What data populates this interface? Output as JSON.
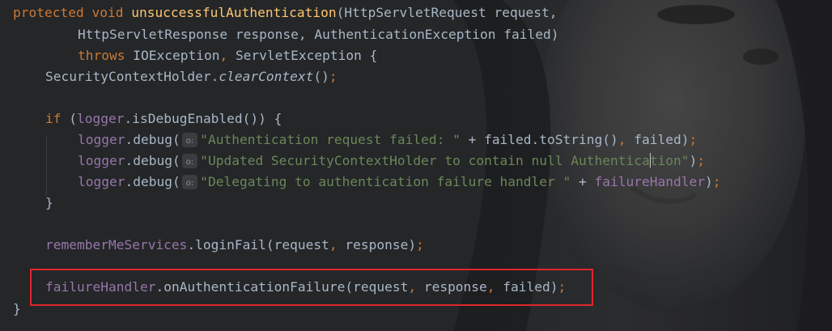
{
  "editor": {
    "theme": "dark",
    "colors": {
      "background": "#242628",
      "keyword": "#cc7832",
      "method_declaration": "#ffc66d",
      "identifier": "#a9b7c6",
      "field": "#9876aa",
      "string": "#6a8759",
      "highlight_box": "#e0262b"
    },
    "hint_icon": "parameter-name-hint-icon",
    "hint_label": "o:",
    "lines": {
      "l1": {
        "kw_protected": "protected",
        "kw_void": "void",
        "method_name": "unsuccessfulAuthentication",
        "rest": "(HttpServletRequest request,"
      },
      "l2": {
        "text1": "HttpServletResponse response, AuthenticationException failed)"
      },
      "l3": {
        "kw_throws": "throws",
        "text1": "IOException",
        "comma": ",",
        "text2": "ServletException {"
      },
      "l4": {
        "text1": "SecurityContextHolder.",
        "method": "clearContext",
        "text2": "()",
        "semi": ";"
      },
      "l6": {
        "kw_if": "if",
        "text1": "(",
        "field": "logger",
        "text2": ".isDebugEnabled()) {"
      },
      "l7": {
        "field": "logger",
        "text1": ".debug(",
        "string": "\"Authentication request failed: \"",
        "text2": "+ failed.toString()",
        "comma": ",",
        "text3": "failed)",
        "semi": ";"
      },
      "l8": {
        "field": "logger",
        "text1": ".debug(",
        "string_a": "\"Updated SecurityContextHolder to contain null Authentica",
        "string_b": "tion\"",
        "text2": ")",
        "semi": ";"
      },
      "l9": {
        "field": "logger",
        "text1": ".debug(",
        "string": "\"Delegating to authentication failure handler \"",
        "text2": "+",
        "field2": "failureHandler",
        "text3": ")",
        "semi": ";"
      },
      "l10": {
        "text1": "}"
      },
      "l12": {
        "field": "rememberMeServices",
        "text1": ".loginFail(request",
        "comma": ",",
        "text2": "response)",
        "semi": ";"
      },
      "l14": {
        "field": "failureHandler",
        "text1": ".onAuthenticationFailure(request",
        "comma1": ",",
        "text2": "response",
        "comma2": ",",
        "text3": "failed)",
        "semi": ";"
      },
      "l15": {
        "text1": "}"
      }
    }
  }
}
